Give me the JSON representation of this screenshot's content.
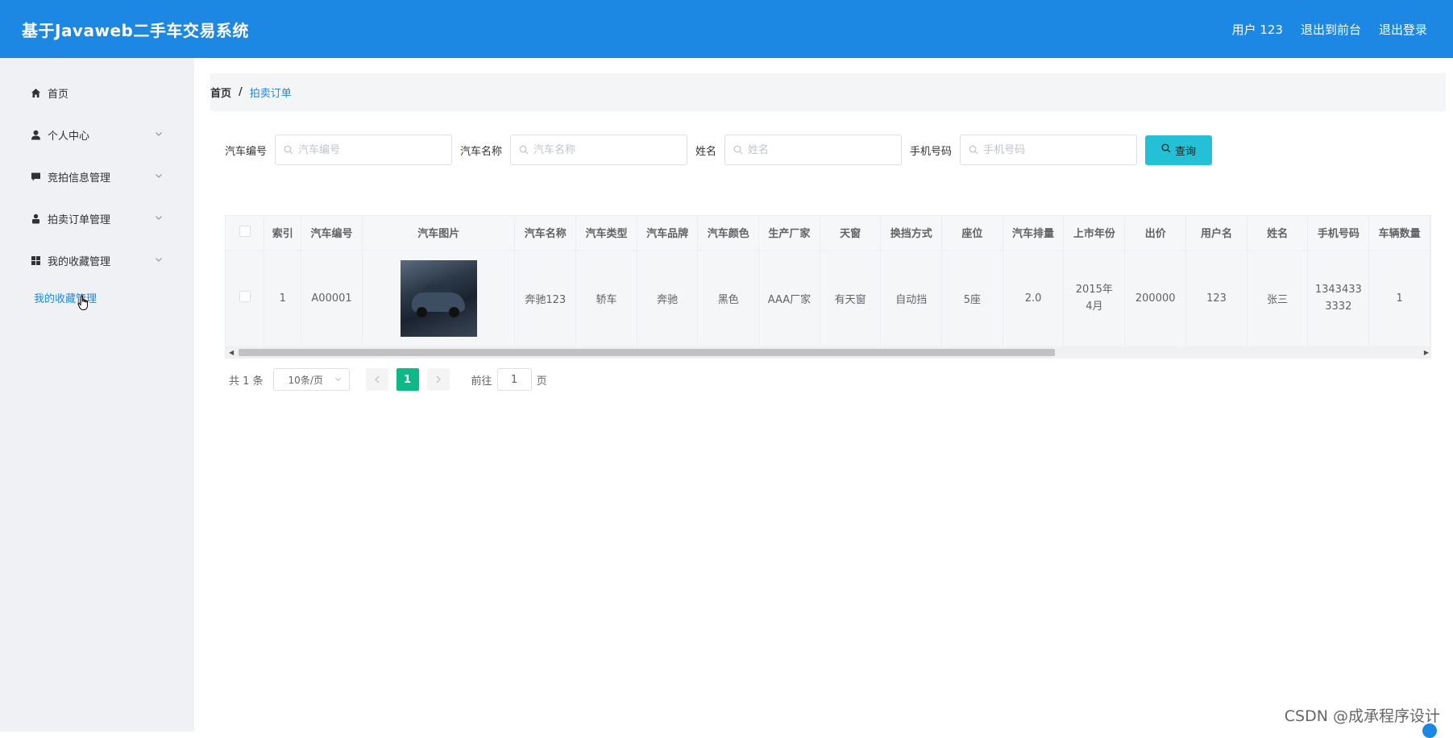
{
  "header": {
    "title": "基于Javaweb二手车交易系统",
    "links": [
      "用户 123",
      "退出到前台",
      "退出登录"
    ]
  },
  "sidebar": {
    "items": [
      {
        "label": "首页",
        "icon": "home-icon",
        "expandable": false
      },
      {
        "label": "个人中心",
        "icon": "user-icon",
        "expandable": true
      },
      {
        "label": "竞拍信息管理",
        "icon": "comment-icon",
        "expandable": true
      },
      {
        "label": "拍卖订单管理",
        "icon": "person-icon",
        "expandable": true
      },
      {
        "label": "我的收藏管理",
        "icon": "grid-icon",
        "expandable": true
      }
    ],
    "submenu": {
      "label": "我的收藏管理"
    }
  },
  "breadcrumb": {
    "home": "首页",
    "separator": "/",
    "current": "拍卖订单"
  },
  "search": {
    "fields": [
      {
        "label": "汽车编号",
        "placeholder": "汽车编号"
      },
      {
        "label": "汽车名称",
        "placeholder": "汽车名称"
      },
      {
        "label": "姓名",
        "placeholder": "姓名"
      },
      {
        "label": "手机号码",
        "placeholder": "手机号码"
      }
    ],
    "button_label": "查询"
  },
  "table": {
    "columns": [
      "索引",
      "汽车编号",
      "汽车图片",
      "汽车名称",
      "汽车类型",
      "汽车品牌",
      "汽车颜色",
      "生产厂家",
      "天窗",
      "换挡方式",
      "座位",
      "汽车排量",
      "上市年份",
      "出价",
      "用户名",
      "姓名",
      "手机号码",
      "车辆数量"
    ],
    "rows": [
      {
        "index": "1",
        "car_no": "A00001",
        "car_name": "奔驰123",
        "car_type": "轿车",
        "brand": "奔驰",
        "color": "黑色",
        "maker": "AAA厂家",
        "sunroof": "有天窗",
        "gearbox": "自动挡",
        "seats": "5座",
        "displacement": "2.0",
        "year": "2015年4月",
        "bid": "200000",
        "username": "123",
        "name": "张三",
        "phone": "13434333332",
        "count": "1"
      }
    ]
  },
  "pagination": {
    "total_text": "共 1 条",
    "page_size": "10条/页",
    "current_page": "1",
    "goto_label": "前往",
    "goto_value": "1",
    "page_unit": "页"
  },
  "watermark": "CSDN @成承程序设计",
  "colors": {
    "header": "#1d87e4",
    "accent": "#1d87e4",
    "query_button": "#24c1d6",
    "active_page": "#0fb887"
  }
}
